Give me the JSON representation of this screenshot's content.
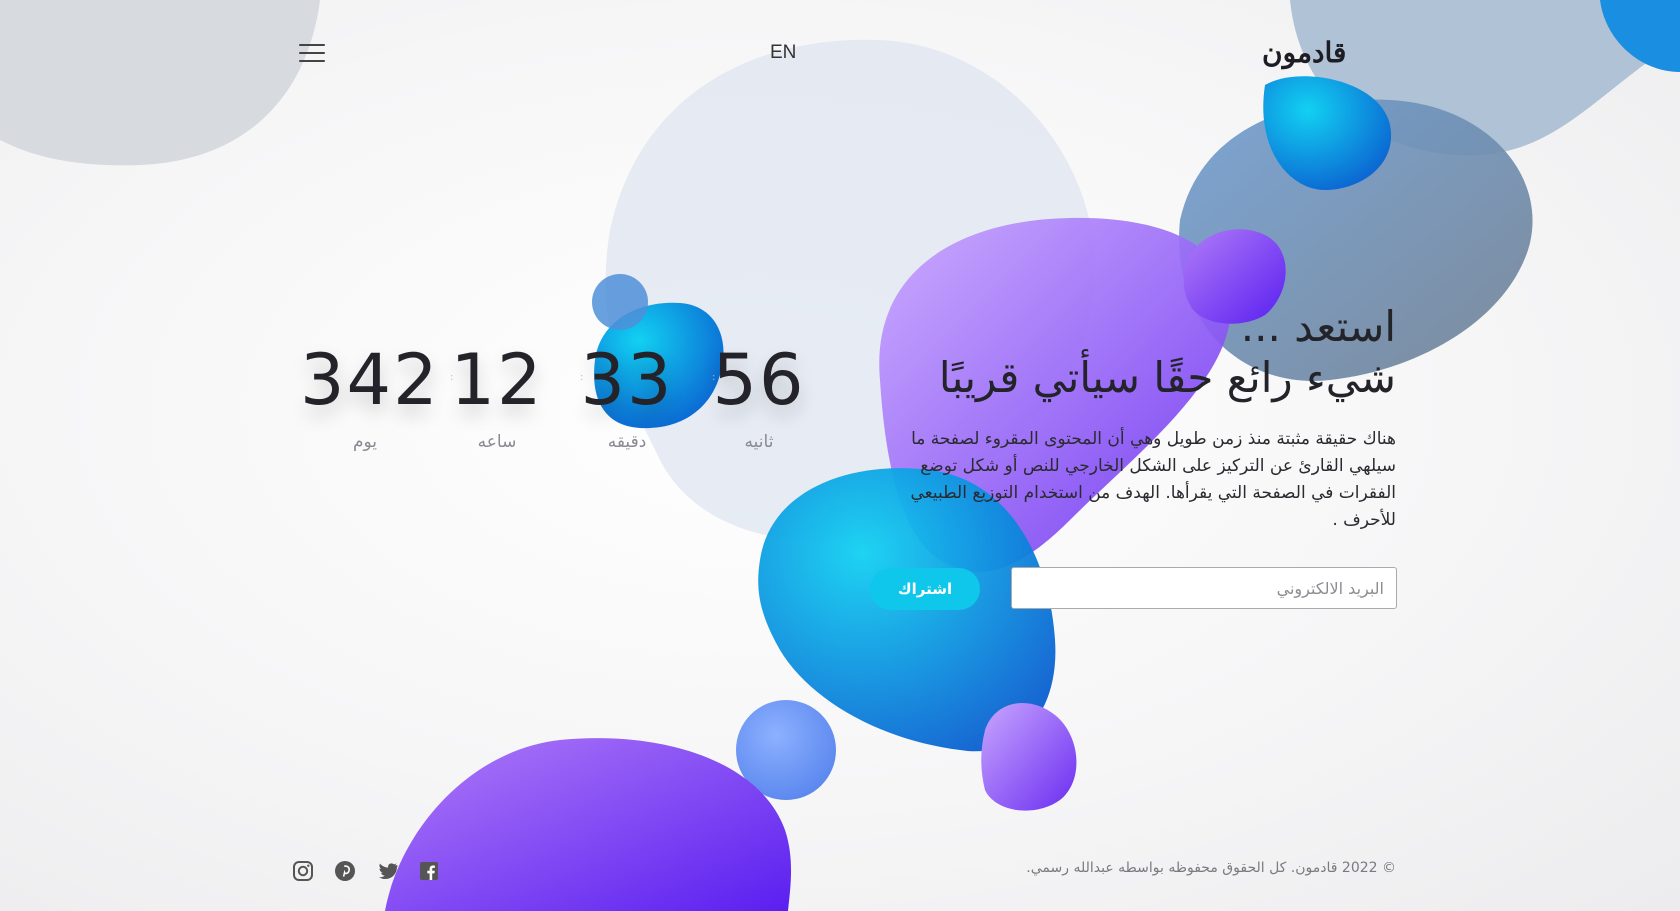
{
  "header": {
    "logo_text": "قادمون",
    "language_label": "EN",
    "menu_icon": "hamburger-icon"
  },
  "countdown": {
    "units": [
      {
        "value": "342",
        "label": "يوم"
      },
      {
        "value": "12",
        "label": "ساعه"
      },
      {
        "value": "33",
        "label": "دقيقه"
      },
      {
        "value": "56",
        "label": "ثانيه"
      }
    ]
  },
  "hero": {
    "line1": "استعد ...",
    "line2": "شيء رائع حقًا سيأتي قريبًا",
    "description": "هناك حقيقة مثبتة منذ زمن طويل وهي أن المحتوى المقروء لصفحة ما سيلهي القارئ عن التركيز على الشكل الخارجي للنص أو شكل توضع الفقرات في الصفحة التي يقرأها. الهدف من استخدام التوزيع الطبيعي للأحرف ."
  },
  "subscribe": {
    "email_placeholder": "البريد الالكتروني",
    "button_label": "اشتراك"
  },
  "footer": {
    "copyright": "© 2022 قادمون. كل الحقوق محفوظه بواسطه عبدالله رسمي.",
    "social_icons": [
      "instagram-icon",
      "pinterest-icon",
      "twitter-icon",
      "facebook-icon"
    ]
  },
  "colors": {
    "accent": "#0fc7ea",
    "purple": "#8b5cf6",
    "blue": "#0a6fd6",
    "text": "#23232a"
  }
}
